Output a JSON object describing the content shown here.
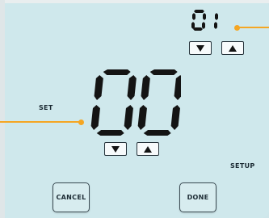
{
  "display": {
    "small_value": "01",
    "big_value": "00"
  },
  "labels": {
    "set": "SET",
    "setup": "SETUP"
  },
  "buttons": {
    "cancel": "CANCEL",
    "done": "DONE"
  },
  "colors": {
    "background": "#cfe8ec",
    "segment": "#141414",
    "callout": "#f5a623"
  },
  "icons": {
    "down": "down-arrow-icon",
    "up": "up-arrow-icon"
  }
}
